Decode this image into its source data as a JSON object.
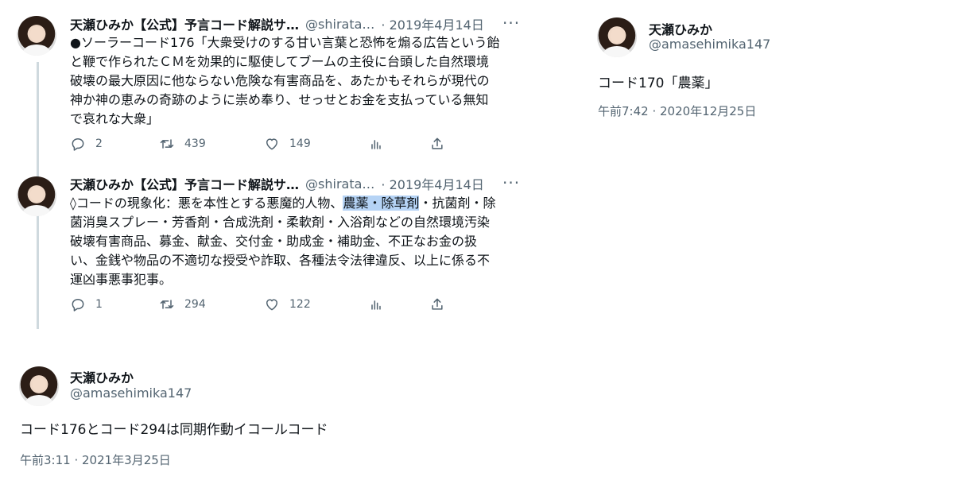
{
  "thread": [
    {
      "name": "天瀬ひみか【公式】予言コード解説サ…",
      "handle": "@shirata…",
      "date": "· 2019年4月14日",
      "text_before": "●ソーラーコード176「大衆受けのする甘い言葉と恐怖を煽る広告という飴\nと鞭で作られたＣＭを効果的に駆使してブームの主役に台頭した自然環境\n破壊の最大原因に他ならない危険な有害商品を、あたかもそれらが現代の\n神か神の恵みの奇跡のように崇め奉り、せっせとお金を支払っている無知\nで哀れな大衆」",
      "text_highlight": "",
      "text_after": "",
      "replies": "2",
      "retweets": "439",
      "likes": "149"
    },
    {
      "name": "天瀬ひみか【公式】予言コード解説サ…",
      "handle": "@shirata…",
      "date": "· 2019年4月14日",
      "text_before": "◊コードの現象化：悪を本性とする悪魔的人物、",
      "text_highlight": "農薬・除草剤",
      "text_after": "・抗菌剤・除\n菌消臭スプレー・芳香剤・合成洗剤・柔軟剤・入浴剤などの自然環境汚染\n破壊有害商品、募金、献金、交付金・助成金・補助金、不正なお金の扱\nい、金銭や物品の不適切な授受や詐取、各種法令法律違反、以上に係る不\n運凶事悪事犯事。",
      "replies": "1",
      "retweets": "294",
      "likes": "122"
    }
  ],
  "post_left": {
    "name": "天瀬ひみか",
    "handle": "@amasehimika147",
    "text": "コード176とコード294は同期作動イコールコード",
    "time": "午前3:11 · 2021年3月25日"
  },
  "post_right": {
    "name": "天瀬ひみか",
    "handle": "@amasehimika147",
    "text": "コード170「農薬」",
    "time": "午前7:42 · 2020年12月25日"
  },
  "icons": [
    "avatar",
    "more-icon",
    "reply-icon",
    "retweet-icon",
    "like-icon",
    "analytics-icon",
    "share-icon"
  ],
  "colors": {
    "text": "#0f1419",
    "secondary": "#536471",
    "highlight": "#b5d3f5",
    "thread_line": "#cfd9de"
  }
}
